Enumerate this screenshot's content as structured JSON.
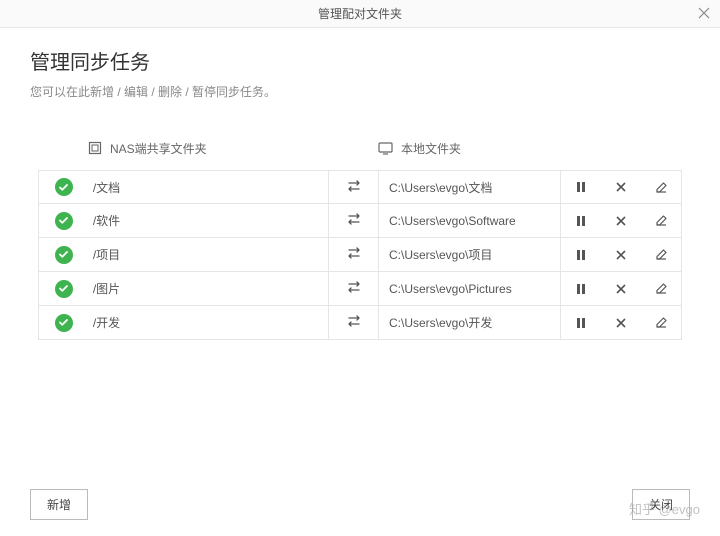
{
  "titlebar": {
    "text": "管理配对文件夹"
  },
  "header": {
    "title": "管理同步任务",
    "subtitle": "您可以在此新增 / 编辑 / 删除 / 暂停同步任务。"
  },
  "columns": {
    "nas_label": "NAS端共享文件夹",
    "local_label": "本地文件夹"
  },
  "rows": [
    {
      "nas": "/文档",
      "local": "C:\\Users\\evgo\\文档"
    },
    {
      "nas": "/软件",
      "local": "C:\\Users\\evgo\\Software"
    },
    {
      "nas": "/项目",
      "local": "C:\\Users\\evgo\\项目"
    },
    {
      "nas": "/图片",
      "local": "C:\\Users\\evgo\\Pictures"
    },
    {
      "nas": "/开发",
      "local": "C:\\Users\\evgo\\开发"
    }
  ],
  "footer": {
    "add_label": "新增",
    "close_label": "关闭"
  },
  "watermark": "知乎 @evgo"
}
